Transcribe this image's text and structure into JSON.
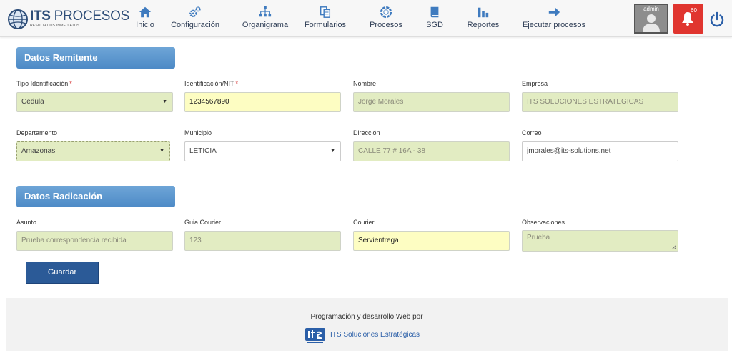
{
  "brand": {
    "name_bold": "ITS",
    "name_rest": " PROCESOS",
    "tagline": "RESULTADOS INMEDIATOS"
  },
  "nav": [
    {
      "label": "Inicio",
      "icon": "home-icon"
    },
    {
      "label": "Configuración",
      "icon": "gears-icon"
    },
    {
      "label": "Organigrama",
      "icon": "sitemap-icon"
    },
    {
      "label": "Formularios",
      "icon": "copy-icon"
    },
    {
      "label": "Procesos",
      "icon": "lifering-icon"
    },
    {
      "label": "SGD",
      "icon": "book-icon"
    },
    {
      "label": "Reportes",
      "icon": "bar-chart-icon"
    },
    {
      "label": "Ejecutar procesos",
      "icon": "arrow-right-icon"
    }
  ],
  "user": {
    "name": "admin"
  },
  "notifications": {
    "count": "60"
  },
  "remitente": {
    "title": "Datos Remitente",
    "tipo_id": {
      "label": "Tipo Identificación",
      "value": "Cedula"
    },
    "identificacion": {
      "label": "Identificación/NIT",
      "value": "1234567890"
    },
    "nombre": {
      "label": "Nombre",
      "value": "Jorge Morales"
    },
    "empresa": {
      "label": "Empresa",
      "value": "ITS SOLUCIONES ESTRATEGICAS"
    },
    "departamento": {
      "label": "Departamento",
      "value": "Amazonas"
    },
    "municipio": {
      "label": "Municipio",
      "value": "LETICIA"
    },
    "direccion": {
      "label": "Dirección",
      "value": "CALLE 77 # 16A - 38"
    },
    "correo": {
      "label": "Correo",
      "value": "jmorales@its-solutions.net"
    }
  },
  "radicacion": {
    "title": "Datos Radicación",
    "asunto": {
      "label": "Asunto",
      "value": "Prueba correspondencia recibida"
    },
    "guia": {
      "label": "Guia Courier",
      "value": "123"
    },
    "courier": {
      "label": "Courier",
      "value": "Servientrega"
    },
    "observaciones": {
      "label": "Observaciones",
      "value": "Prueba"
    }
  },
  "required_mark": "*",
  "save_label": "Guardar",
  "footer": {
    "credit": "Programación y desarrollo Web por",
    "company": "ITS Soluciones Estratégicas"
  },
  "colors": {
    "brand_blue": "#2d4d78",
    "header_blue": "#5b95cd",
    "field_green": "#e2ecc2",
    "field_yellow": "#fdfdc2",
    "alert_red": "#e0352f",
    "button_blue": "#2b5a97"
  }
}
